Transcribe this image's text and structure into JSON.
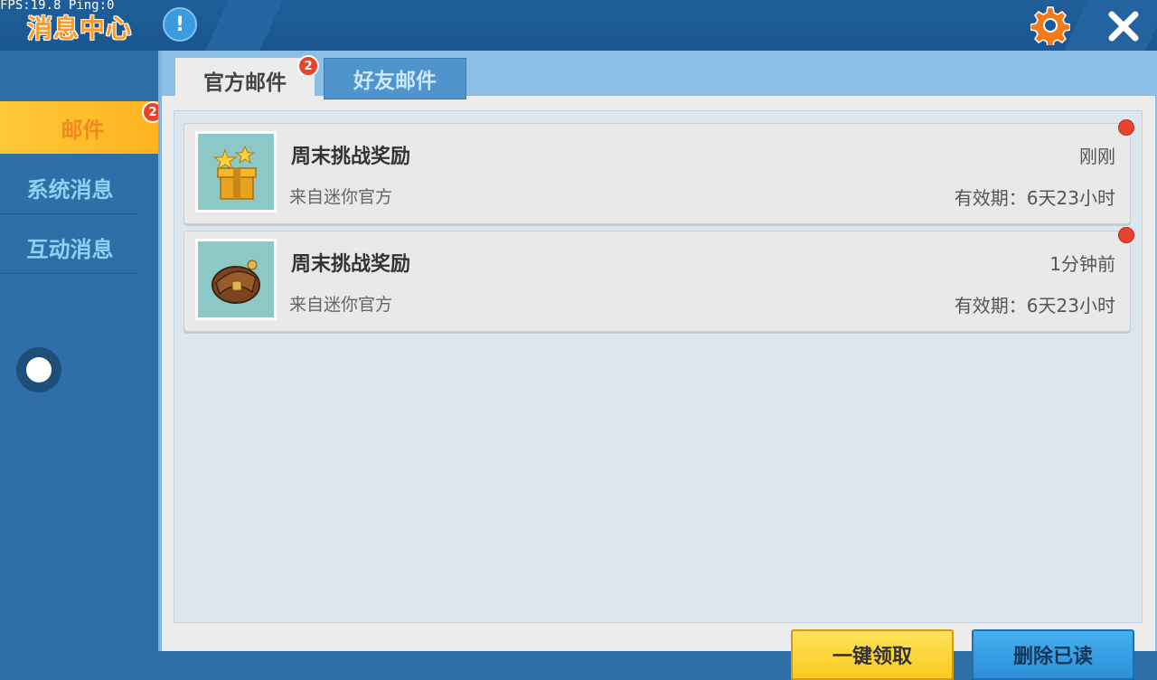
{
  "debug": {
    "fps_text": "FPS:19.8  Ping:0"
  },
  "header": {
    "title": "消息中心",
    "info_icon": "exclamation-icon",
    "settings_icon": "gear-icon",
    "close_icon": "close-icon"
  },
  "sidebar": {
    "items": [
      {
        "label": "邮件",
        "badge": "2",
        "active": true
      },
      {
        "label": "系统消息",
        "active": false
      },
      {
        "label": "互动消息",
        "active": false
      }
    ]
  },
  "tabs": [
    {
      "label": "官方邮件",
      "badge": "2",
      "active": true
    },
    {
      "label": "好友邮件",
      "active": false
    }
  ],
  "mails": [
    {
      "title": "周末挑战奖励",
      "sender": "来自迷你官方",
      "time": "刚刚",
      "expiry": "有效期：6天23小时",
      "icon": "gift-box-icon",
      "unread": true
    },
    {
      "title": "周末挑战奖励",
      "sender": "来自迷你官方",
      "time": "1分钟前",
      "expiry": "有效期：6天23小时",
      "icon": "backpack-icon",
      "unread": true
    }
  ],
  "actions": {
    "claim_all": "一键领取",
    "delete_read": "删除已读"
  },
  "colors": {
    "accent_orange": "#ff9a26",
    "badge_red": "#e8432d",
    "claim_yellow": "#f9c91f",
    "delete_blue": "#2d8fd6"
  }
}
